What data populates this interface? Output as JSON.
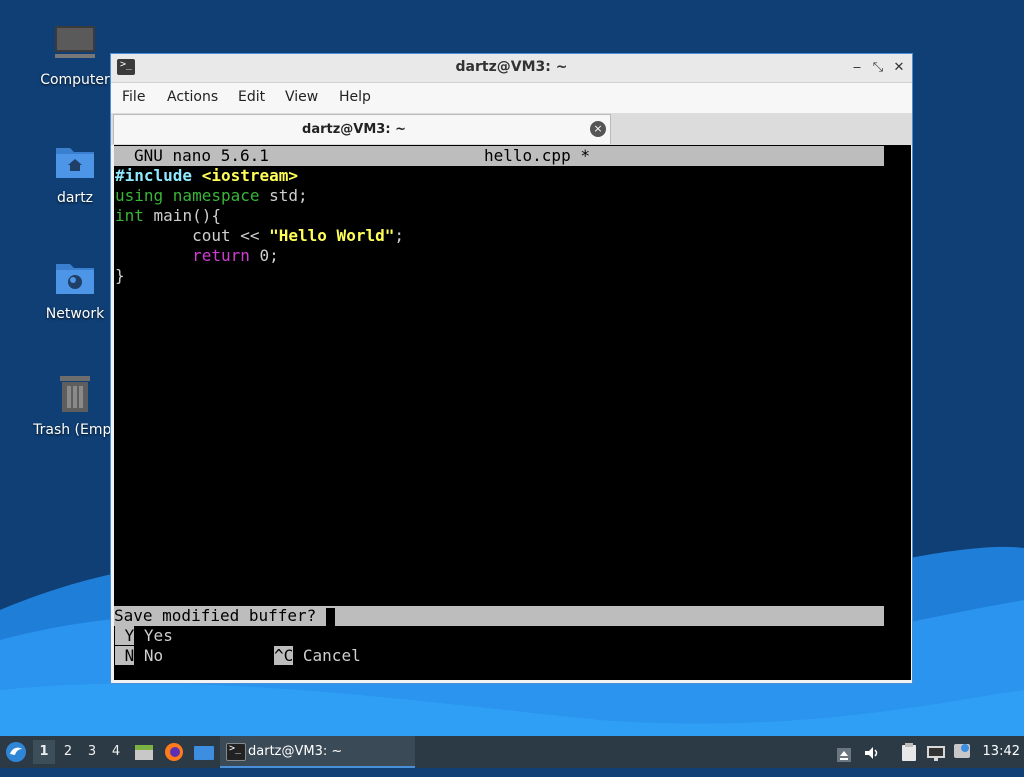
{
  "desktop": {
    "icons": [
      {
        "label": "Computer"
      },
      {
        "label": "dartz"
      },
      {
        "label": "Network"
      },
      {
        "label": "Trash (Empt"
      }
    ]
  },
  "window": {
    "title": "dartz@VM3: ~",
    "controls": {
      "minimize": "‒",
      "maximize": "⤡",
      "close": "✕"
    },
    "menu": [
      "File",
      "Actions",
      "Edit",
      "View",
      "Help"
    ],
    "tab": {
      "label": "dartz@VM3: ~",
      "close": "×"
    }
  },
  "nano": {
    "version": "GNU nano 5.6.1",
    "filename": "hello.cpp *",
    "code": {
      "l1_directive": "#include",
      "l1_header": "<iostream>",
      "l2_kw": "using namespace",
      "l2_rest": " std;",
      "l3_kw": "int",
      "l3_rest": " main(){",
      "l4_indent": "        cout << ",
      "l4_string": "\"Hello World\"",
      "l4_end": ";",
      "l5_indent": "        ",
      "l5_kw": "return",
      "l5_rest": " 0;",
      "l6": "}"
    },
    "prompt": "Save modified buffer? ",
    "options": [
      {
        "key": "Y",
        "label": "Yes"
      },
      {
        "key": "N",
        "label": "No"
      },
      {
        "key": "^C",
        "label": "Cancel"
      }
    ]
  },
  "taskbar": {
    "workspaces": [
      "1",
      "2",
      "3",
      "4"
    ],
    "active_workspace": "1",
    "task_label": "dartz@VM3: ~",
    "clock": "13:42"
  },
  "colors": {
    "accent": "#4a90d9",
    "terminal_bg": "#000000",
    "statusbar_bg": "#bdbdbd"
  }
}
